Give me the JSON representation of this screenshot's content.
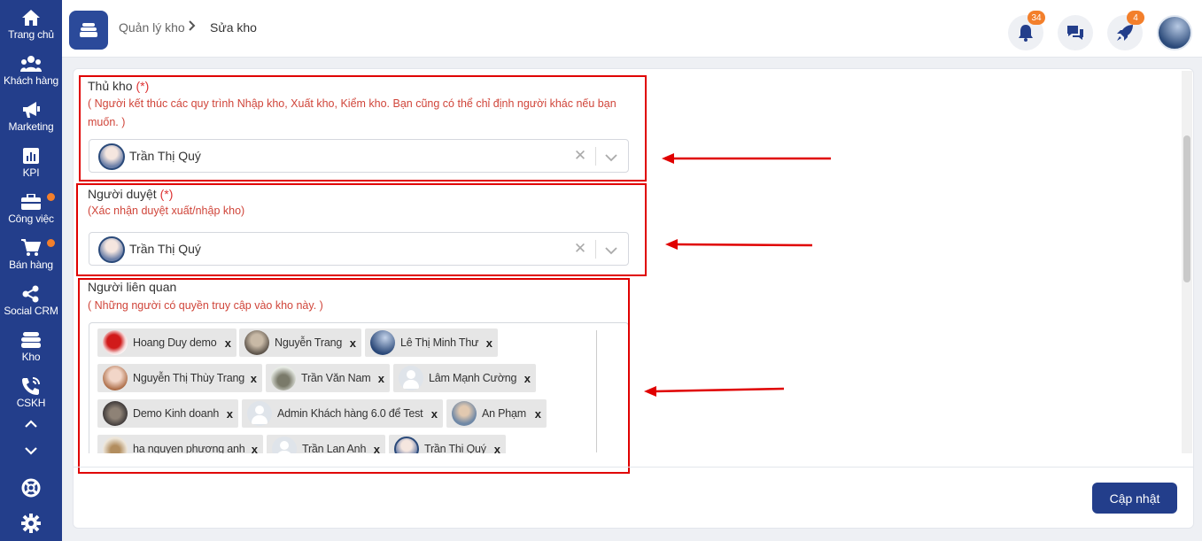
{
  "sidebar": {
    "items": [
      {
        "label": "Trang chủ",
        "icon": "home-icon"
      },
      {
        "label": "Khách hàng",
        "icon": "users-icon"
      },
      {
        "label": "Marketing",
        "icon": "megaphone-icon"
      },
      {
        "label": "KPI",
        "icon": "chart-icon"
      },
      {
        "label": "Công việc",
        "icon": "briefcase-icon"
      },
      {
        "label": "Bán hàng",
        "icon": "cart-icon"
      },
      {
        "label": "Social CRM",
        "icon": "share-icon"
      },
      {
        "label": "Kho",
        "icon": "warehouse-icon"
      },
      {
        "label": "CSKH",
        "icon": "phone-icon"
      }
    ],
    "notification_dot_color": "#f37f2b"
  },
  "header": {
    "breadcrumb": [
      "Quản lý kho",
      "Sửa kho"
    ],
    "notification_count": "34",
    "rocket_count": "4"
  },
  "form": {
    "thu_kho": {
      "label": "Thủ kho",
      "required_mark": "(*)",
      "hint": "( Người kết thúc các quy trình Nhập kho, Xuất kho, Kiểm kho. Bạn cũng có thể chỉ định người khác nếu bạn muốn. )",
      "value": "Trần Thị Quý"
    },
    "nguoi_duyet": {
      "label": "Người duyệt",
      "required_mark": "(*)",
      "hint": "(Xác nhận duyệt xuất/nhập kho)",
      "value": "Trần Thị Quý"
    },
    "nguoi_lien_quan": {
      "label": "Người liên quan",
      "hint": "( Những người có quyền truy cập vào kho này. )",
      "tags": [
        "Hoang Duy demo",
        "Nguyễn Trang",
        "Lê Thị Minh Thư",
        "Nguyễn Thị Thùy Trang",
        "Trần Văn Nam",
        "Lâm Mạnh Cường",
        "Demo Kinh doanh",
        "Admin Khách hàng 6.0 để Test",
        "An Phạm",
        "ha nguyen phương anh",
        "Trần Lan Anh",
        "Trần Thị Quý"
      ],
      "remove_symbol": "x"
    }
  },
  "actions": {
    "update_label": "Cập nhật"
  },
  "colors": {
    "sidebar_bg": "#233e8b",
    "accent": "#233e8b",
    "hint_red": "#d0453a",
    "annotation_red": "#e00000",
    "badge_orange": "#f37f2b"
  }
}
